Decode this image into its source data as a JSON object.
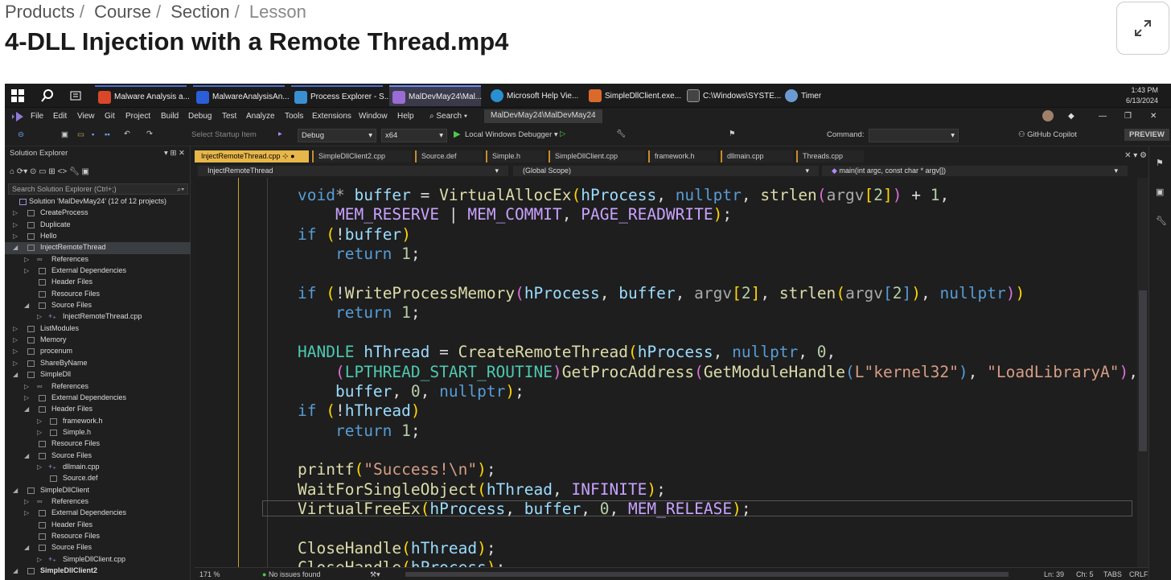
{
  "breadcrumb": {
    "items": [
      "Products",
      "Course",
      "Section"
    ],
    "current": "Lesson"
  },
  "page_title": "4-DLL Injection with a Remote Thread.mp4",
  "taskbar": {
    "items": [
      {
        "label": "Malware Analysis a...",
        "color": "#d9472b"
      },
      {
        "label": "MalwareAnalysisAn...",
        "color": "#2b5fd9"
      },
      {
        "label": "Process Explorer - S...",
        "color": "#3a8fd0"
      },
      {
        "label": "MalDevMay24\\Mal...",
        "color": "#9b6bd6"
      },
      {
        "label": "Microsoft Help Vie...",
        "color": "#2a8fd0"
      },
      {
        "label": "SimpleDllClient.exe...",
        "color": "#d96a2b"
      },
      {
        "label": "C:\\Windows\\SYSTE...",
        "color": "#444444"
      },
      {
        "label": "Timer",
        "color": "#6a9ad0"
      }
    ],
    "time": "1:43 PM",
    "date": "6/13/2024"
  },
  "menu": [
    "File",
    "Edit",
    "View",
    "Git",
    "Project",
    "Build",
    "Debug",
    "Test",
    "Analyze",
    "Tools",
    "Extensions",
    "Window",
    "Help"
  ],
  "menu_search": "Search",
  "solution_title_box": "MalDevMay24\\MalDevMay24",
  "toolbar": {
    "startup_item": "Select Startup Item",
    "config": "Debug",
    "platform": "x64",
    "debugger": "Local Windows Debugger",
    "command_label": "Command:",
    "copilot": "GitHub Copilot",
    "preview": "PREVIEW"
  },
  "solution_explorer": {
    "title": "Solution Explorer",
    "search_placeholder": "Search Solution Explorer (Ctrl+;)",
    "tree": [
      "Solution 'MalDevMay24' (12 of 12 projects)",
      "CreateProcess",
      "Duplicate",
      "Hello",
      "InjectRemoteThread",
      "References",
      "External Dependencies",
      "Header Files",
      "Resource Files",
      "Source Files",
      "InjectRemoteThread.cpp",
      "ListModules",
      "Memory",
      "procenum",
      "ShareByName",
      "SimpleDll",
      "References",
      "External Dependencies",
      "Header Files",
      "framework.h",
      "Simple.h",
      "Resource Files",
      "Source Files",
      "dllmain.cpp",
      "Source.def",
      "SimpleDllClient",
      "References",
      "External Dependencies",
      "Header Files",
      "Resource Files",
      "Source Files",
      "SimpleDllClient.cpp",
      "SimpleDllClient2"
    ]
  },
  "tabs": [
    "InjectRemoteThread.cpp",
    "SimpleDllClient2.cpp",
    "Source.def",
    "Simple.h",
    "SimpleDllClient.cpp",
    "framework.h",
    "dllmain.cpp",
    "Threads.cpp"
  ],
  "nav": {
    "project": "InjectRemoteThread",
    "scope": "(Global Scope)",
    "member": "main(int argc, const char * argv[])"
  },
  "code": [
    "void* buffer = VirtualAllocEx(hProcess, nullptr, strlen(argv[2]) + 1,",
    "    MEM_RESERVE | MEM_COMMIT, PAGE_READWRITE);",
    "if (!buffer)",
    "    return 1;",
    "",
    "if (!WriteProcessMemory(hProcess, buffer, argv[2], strlen(argv[2]), nullptr))",
    "    return 1;",
    "",
    "HANDLE hThread = CreateRemoteThread(hProcess, nullptr, 0,",
    "    (LPTHREAD_START_ROUTINE)GetProcAddress(GetModuleHandle(L\"kernel32\"), \"LoadLibraryA\"),",
    "    buffer, 0, nullptr);",
    "if (!hThread)",
    "    return 1;",
    "",
    "printf(\"Success!\\n\");",
    "WaitForSingleObject(hThread, INFINITE);",
    "VirtualFreeEx(hProcess, buffer, 0, MEM_RELEASE);",
    "",
    "CloseHandle(hThread);",
    "CloseHandle(hProcess);"
  ],
  "status": {
    "zoom": "171 %",
    "issues": "No issues found",
    "ln": "Ln: 39",
    "ch": "Ch: 5",
    "tabs": "TABS",
    "eol": "CRLF"
  }
}
